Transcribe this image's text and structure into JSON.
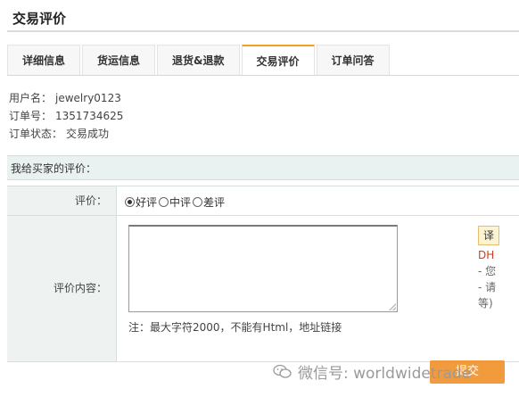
{
  "page": {
    "title": "交易评价"
  },
  "tabs": [
    {
      "label": "详细信息"
    },
    {
      "label": "货运信息"
    },
    {
      "label": "退货&退款"
    },
    {
      "label": "交易评价"
    },
    {
      "label": "订单问答"
    }
  ],
  "active_tab": "交易评价",
  "order_info": {
    "username_label": "用户名：",
    "username": "jewelry0123",
    "order_no_label": "订单号：",
    "order_no": "1351734625",
    "status_label": "订单状态：",
    "status": "交易成功"
  },
  "section": {
    "title": "我给买家的评价："
  },
  "form": {
    "rating_label": "评价：",
    "rating_options": [
      "好评",
      "中评",
      "差评"
    ],
    "rating_selected": "好评",
    "content_label": "评价内容：",
    "content_value": "",
    "note": "注：最大字符2000，不能有Html，地址链接"
  },
  "sidebar_tip": {
    "translate_label": "译",
    "brand": "DH",
    "line1": "- 您",
    "line2": "- 请",
    "line3": "等)"
  },
  "watermark": {
    "text": "微信号: worldwidetrade"
  },
  "submit": {
    "label": "提交"
  },
  "colors": {
    "accent": "#f0a020",
    "submit": "#f08a1c",
    "section_bg": "#eaf2f1",
    "brand_red": "#d23a1a"
  },
  "icons": {
    "watermark": "wechat-icon",
    "resize": "resize-grip-icon"
  }
}
